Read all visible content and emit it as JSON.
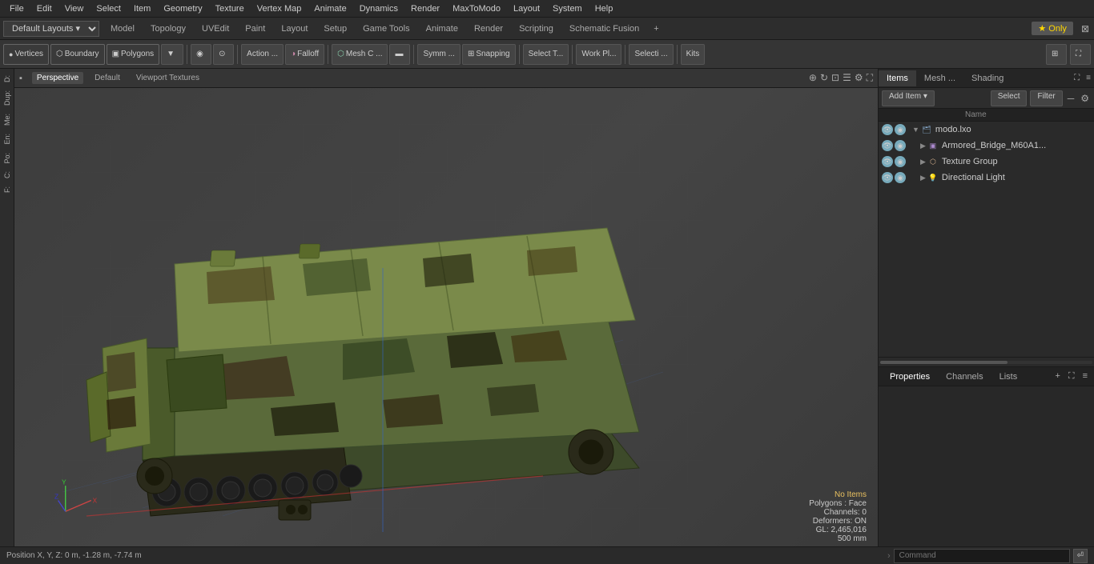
{
  "menu": {
    "items": [
      "File",
      "Edit",
      "View",
      "Select",
      "Item",
      "Geometry",
      "Texture",
      "Vertex Map",
      "Animate",
      "Dynamics",
      "Render",
      "MaxToModo",
      "Layout",
      "System",
      "Help"
    ]
  },
  "layout_bar": {
    "dropdown_label": "Default Layouts",
    "tabs": [
      {
        "label": "Model",
        "active": false
      },
      {
        "label": "Topology",
        "active": false
      },
      {
        "label": "UVEdit",
        "active": false
      },
      {
        "label": "Paint",
        "active": false
      },
      {
        "label": "Layout",
        "active": false
      },
      {
        "label": "Setup",
        "active": false
      },
      {
        "label": "Game Tools",
        "active": false
      },
      {
        "label": "Animate",
        "active": false
      },
      {
        "label": "Render",
        "active": false
      },
      {
        "label": "Scripting",
        "active": false
      },
      {
        "label": "Schematic Fusion",
        "active": false
      }
    ],
    "star_only": "★  Only",
    "plus": "+"
  },
  "toolbar": {
    "buttons": [
      {
        "label": "Vertices",
        "icon": "●"
      },
      {
        "label": "Boundary",
        "icon": "⬡"
      },
      {
        "label": "Polygons",
        "icon": "▣"
      },
      {
        "label": "",
        "icon": "▼"
      },
      {
        "label": "",
        "icon": "◉"
      },
      {
        "label": "Action ...",
        "icon": ""
      },
      {
        "label": "Falloff",
        "icon": ""
      },
      {
        "label": "Mesh C ...",
        "icon": ""
      },
      {
        "label": "",
        "icon": ""
      },
      {
        "label": "Symm ...",
        "icon": ""
      },
      {
        "label": "Snapping",
        "icon": "⊞"
      },
      {
        "label": "Select T...",
        "icon": ""
      },
      {
        "label": "Work Pl...",
        "icon": ""
      },
      {
        "label": "Selecti ...",
        "icon": ""
      },
      {
        "label": "Kits",
        "icon": ""
      }
    ]
  },
  "viewport": {
    "tabs": [
      {
        "label": "Perspective",
        "active": true
      },
      {
        "label": "Default",
        "active": false
      },
      {
        "label": "Viewport Textures",
        "active": false
      }
    ],
    "status": {
      "no_items": "No Items",
      "polygons": "Polygons : Face",
      "channels": "Channels: 0",
      "deformers": "Deformers: ON",
      "gl": "GL: 2,465,016",
      "size": "500 mm"
    }
  },
  "left_sidebar": {
    "tabs": [
      "D:",
      "Dup:",
      "Me:",
      "En:",
      "Po:",
      "C:",
      "F:"
    ]
  },
  "right_panel": {
    "tabs": [
      {
        "label": "Items",
        "active": true
      },
      {
        "label": "Mesh ...",
        "active": false
      },
      {
        "label": "Shading",
        "active": false
      }
    ],
    "items_toolbar": {
      "add_item": "Add Item",
      "select": "Select",
      "filter": "Filter"
    },
    "tree": [
      {
        "label": "modo.lxo",
        "type": "scene",
        "depth": 0,
        "expanded": true,
        "children": [
          {
            "label": "Armored_Bridge_M60A1...",
            "type": "mesh",
            "depth": 1,
            "expanded": false
          },
          {
            "label": "Texture Group",
            "type": "group",
            "depth": 1,
            "expanded": false
          },
          {
            "label": "Directional Light",
            "type": "light",
            "depth": 1,
            "expanded": false
          }
        ]
      }
    ]
  },
  "properties": {
    "tabs": [
      {
        "label": "Properties",
        "active": true
      },
      {
        "label": "Channels",
        "active": false
      },
      {
        "label": "Lists",
        "active": false
      }
    ]
  },
  "status_bar": {
    "position": "Position X, Y, Z:  0 m, -1.28 m, -7.74 m",
    "command_label": "Command",
    "command_placeholder": "Command"
  }
}
